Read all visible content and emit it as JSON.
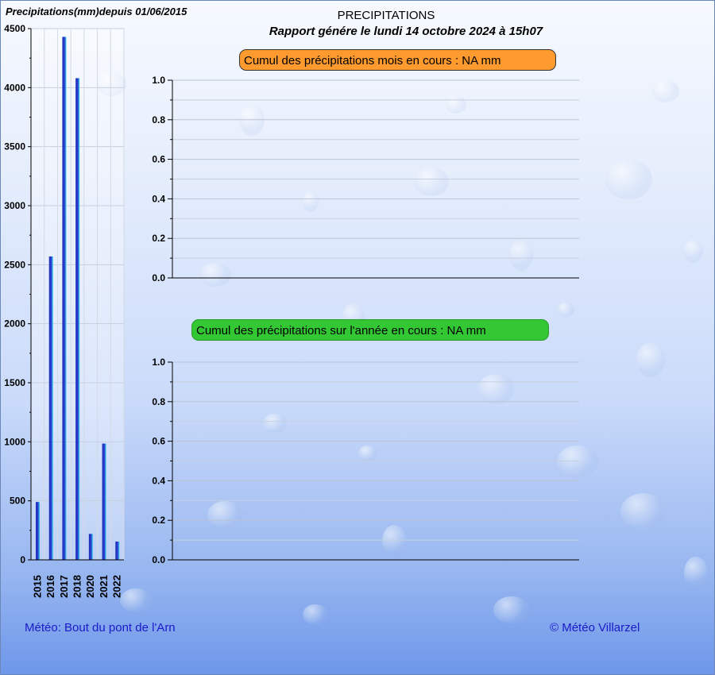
{
  "header": {
    "side_title": "Precipitations(mm)depuis 01/06/2015",
    "title": "PRECIPITATIONS",
    "subtitle": "Rapport génére le lundi 14 octobre 2024 à 15h07"
  },
  "chart_data": [
    {
      "type": "bar",
      "title": "Precipitations(mm)depuis 01/06/2015",
      "categories": [
        "2015",
        "2016",
        "2017",
        "2018",
        "2020",
        "2021",
        "2022"
      ],
      "values": [
        490,
        2570,
        4430,
        4080,
        220,
        985,
        155
      ],
      "y_ticks": [
        "0",
        "500",
        "1000",
        "1500",
        "2000",
        "2500",
        "3000",
        "3500",
        "4000",
        "4500"
      ],
      "ylim": [
        0,
        4500
      ],
      "grid": true,
      "bar_color": "#2a3ccf"
    },
    {
      "type": "line",
      "title": "Cumul des précipitations mois en cours : NA mm",
      "series": [],
      "y_ticks": [
        "0.0",
        "0.2",
        "0.4",
        "0.6",
        "0.8",
        "1.0"
      ],
      "ylim": [
        0,
        1
      ],
      "grid": true,
      "label_color": "#ff9a2e"
    },
    {
      "type": "line",
      "title": "Cumul des précipitations sur l'année en cours : NA mm",
      "series": [],
      "y_ticks": [
        "0.0",
        "0.2",
        "0.4",
        "0.6",
        "0.8",
        "1.0"
      ],
      "ylim": [
        0,
        1
      ],
      "grid": true,
      "label_color": "#33c733"
    }
  ],
  "footer": {
    "left": "Météo: Bout du pont de l'Arn",
    "right": "© Météo Villarzel"
  }
}
